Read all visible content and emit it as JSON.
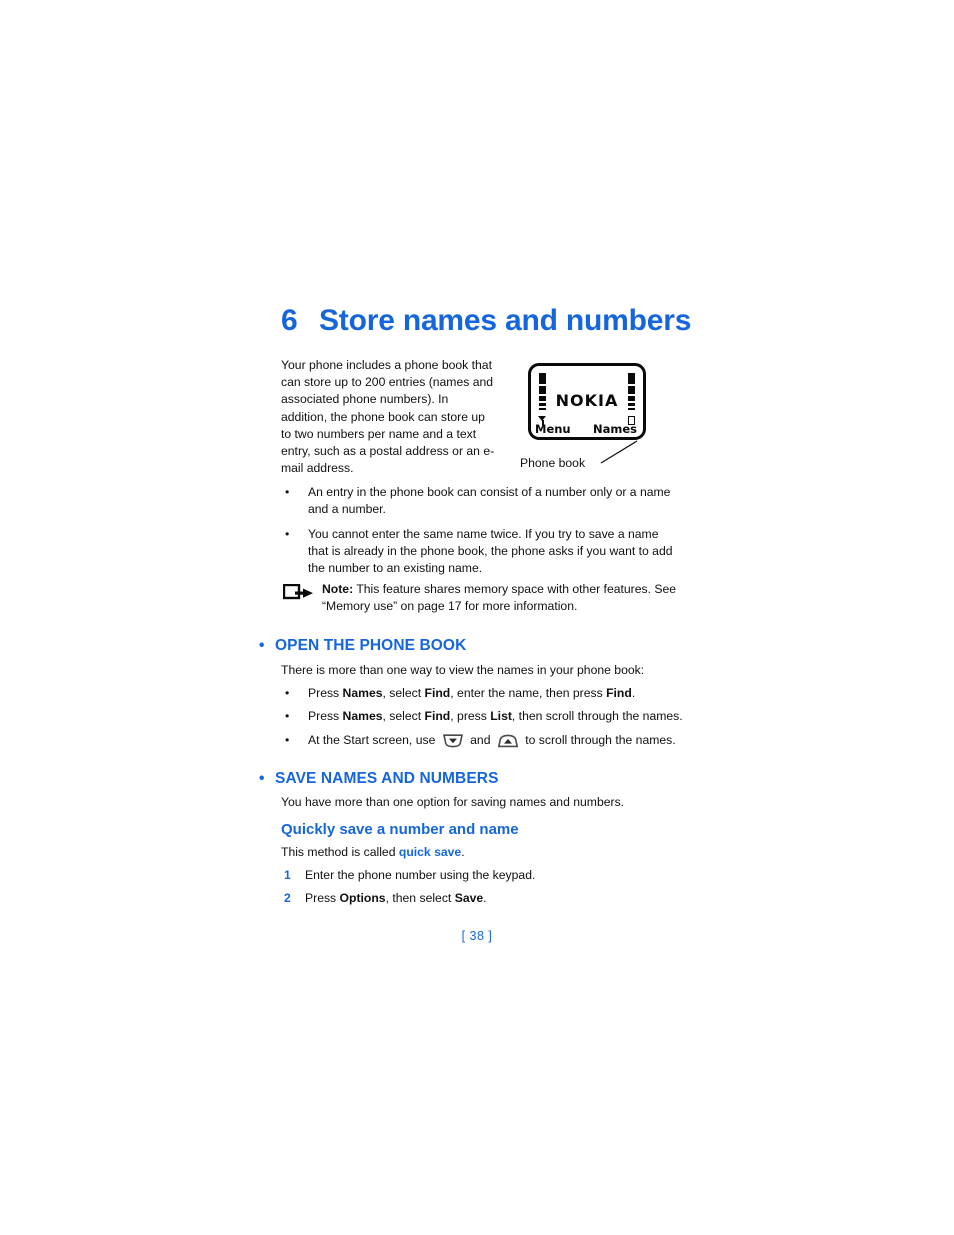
{
  "document": {
    "chapter_number": "6",
    "chapter_title": "Store names and numbers",
    "page_number": "[ 38 ]",
    "accent_color": "#1566dd",
    "text_color": "#111111"
  },
  "intro": {
    "paragraph": "Your phone includes a phone book that can store up to 200 entries (names and associated phone numbers). In addition, the phone book can store up to two numbers per name and a text entry, such as a postal address or an e-mail address.",
    "bullets": [
      "An entry in the phone book can consist of a number only or a name and a number.",
      "You cannot enter the same name twice. If you try to save a name that is already in the phone book, the phone asks if you want to add the number to an existing name."
    ],
    "bullet_marker": "•"
  },
  "figure": {
    "caption": "Phone book",
    "screen": {
      "brand_text": "NOKIA",
      "softkey_left": "Menu",
      "softkey_right": "Names",
      "signal_indicator": "signal-bars-icon",
      "battery_indicator": "battery-bars-icon"
    }
  },
  "note": {
    "label": "Note:",
    "text_part1": " This feature shares memory space with other features. See “Memory use” on page 17 for more information.",
    "icon": "note-arrow-icon"
  },
  "sections": [
    {
      "id": "open",
      "heading": "OPEN THE PHONE BOOK",
      "lead": "There is more than one way to view the names in your phone book:",
      "steps": [
        {
          "segments": [
            {
              "text": "Press ",
              "bold": false
            },
            {
              "text": "Names",
              "bold": true
            },
            {
              "text": ", select ",
              "bold": false
            },
            {
              "text": "Find",
              "bold": true
            },
            {
              "text": ", enter the name, then press ",
              "bold": false
            },
            {
              "text": "Find",
              "bold": true
            },
            {
              "text": ".",
              "bold": false
            }
          ]
        },
        {
          "segments": [
            {
              "text": "Press ",
              "bold": false
            },
            {
              "text": "Names",
              "bold": true
            },
            {
              "text": ", select ",
              "bold": false
            },
            {
              "text": "Find",
              "bold": true
            },
            {
              "text": ", press ",
              "bold": false
            },
            {
              "text": "List",
              "bold": true
            },
            {
              "text": ", then scroll through the names.",
              "bold": false
            }
          ]
        },
        {
          "segments": [
            {
              "text": "At the Start screen, use ",
              "bold": false
            },
            {
              "icon": "scroll-down-key-icon"
            },
            {
              "text": " and ",
              "bold": false
            },
            {
              "icon": "scroll-up-key-icon"
            },
            {
              "text": " to scroll through the names.",
              "bold": false
            }
          ]
        }
      ]
    },
    {
      "id": "save",
      "heading": "SAVE NAMES AND NUMBERS",
      "lead": "You have more than one option for saving names and numbers."
    }
  ],
  "subsection": {
    "heading": "Quickly save a number and name",
    "lead_prefix": "This method is called ",
    "lead_term": "quick save",
    "lead_suffix": ".",
    "steps": [
      {
        "number": "1",
        "segments": [
          {
            "text": "Enter the phone number using the keypad.",
            "bold": false
          }
        ]
      },
      {
        "number": "2",
        "segments": [
          {
            "text": "Press ",
            "bold": false
          },
          {
            "text": "Options",
            "bold": true
          },
          {
            "text": ", then select ",
            "bold": false
          },
          {
            "text": "Save",
            "bold": true
          },
          {
            "text": ".",
            "bold": false
          }
        ]
      }
    ]
  }
}
